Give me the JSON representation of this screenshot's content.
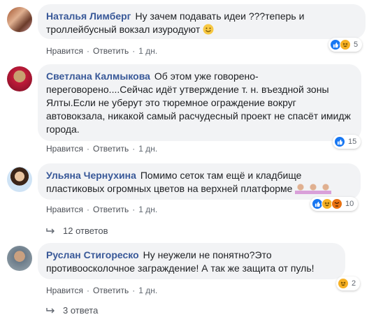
{
  "comments": [
    {
      "author": "Наталья Лимберг",
      "text": "Ну зачем подавать идеи ???теперь и троллейбусный вокзал изуродуют",
      "actions": {
        "like": "Нравится",
        "reply": "Ответить",
        "time": "1 дн."
      },
      "reactions": {
        "icons": [
          "like",
          "haha"
        ],
        "count": "5"
      }
    },
    {
      "author": "Светлана Калмыкова",
      "text": "Об этом уже говорено-переговорено....Сейчас идёт утверждение т. н. въездной зоны Ялты.Если не уберут это тюремное ограждение вокруг автовокзала, никакой самый расчудесный проект не спасёт имидж города.",
      "actions": {
        "like": "Нравится",
        "reply": "Ответить",
        "time": "1 дн."
      },
      "reactions": {
        "icons": [
          "like"
        ],
        "count": "15"
      }
    },
    {
      "author": "Ульяна Чернухина",
      "text": "Помимо сеток там ещё и кладбище пластиковых огромных цветов на верхней платформе",
      "actions": {
        "like": "Нравится",
        "reply": "Ответить",
        "time": "1 дн."
      },
      "reactions": {
        "icons": [
          "like",
          "haha",
          "angry"
        ],
        "count": "10"
      },
      "replies": "12 ответов"
    },
    {
      "author": "Руслан Стигореско",
      "text": "Ну неужели не понятно?Это противоосколочное заграждение! А так же защита от пуль!",
      "actions": {
        "like": "Нравится",
        "reply": "Ответить",
        "time": "1 дн."
      },
      "reactions": {
        "icons": [
          "haha"
        ],
        "count": "2"
      },
      "replies": "3 ответа"
    }
  ],
  "colors": {
    "name": "#385898",
    "bubble": "#f2f3f5",
    "like": "#1877f2",
    "haha": "#f7b125",
    "angry": "#e9710f"
  }
}
